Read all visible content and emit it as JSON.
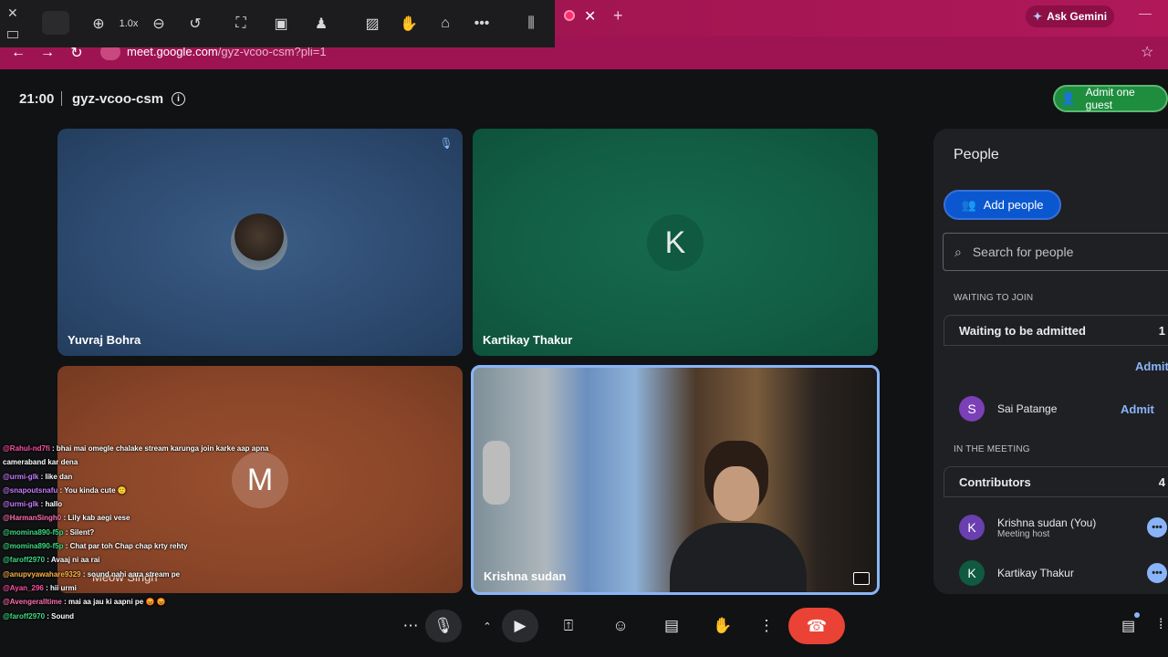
{
  "browser": {
    "url_host": "meet.google.com",
    "url_path": "/gyz-vcoo-csm?pli=1",
    "ask_gemini": "Ask Gemini",
    "tab_new": "+"
  },
  "screen_toolbar": {
    "speed": "1.0x"
  },
  "meeting": {
    "time": "21:00",
    "code": "gyz-vcoo-csm",
    "admit_one_guest": "Admit one guest"
  },
  "tiles": [
    {
      "name": "Yuvraj Bohra",
      "muted": true
    },
    {
      "name": "Kartikay Thakur",
      "initial": "K"
    },
    {
      "name": "Meow Singh",
      "initial": "M"
    },
    {
      "name": "Krishna sudan"
    }
  ],
  "chat": [
    {
      "user": "@Rahul-nd7fi",
      "color": "#ff4fa3",
      "text": "bhai mai omegle chalake stream karunga join karke aap apna"
    },
    {
      "user": "",
      "color": "#ffffff",
      "text": "cameraband kar dena"
    },
    {
      "user": "@urmi-glk",
      "color": "#c77dff",
      "text": "like dan"
    },
    {
      "user": "@snapoutsnafu",
      "color": "#c77dff",
      "text": "You kinda cute 🙂"
    },
    {
      "user": "@urmi-glk",
      "color": "#c77dff",
      "text": "hallo"
    },
    {
      "user": "@HarmanSingh0",
      "color": "#ff6fb1",
      "text": "Lily kab aegi vese"
    },
    {
      "user": "@momina890-f5p",
      "color": "#3ddc84",
      "text": "Silent?"
    },
    {
      "user": "@momina890-f5p",
      "color": "#3ddc84",
      "text": "Chat par toh Chap chap krty rehty"
    },
    {
      "user": "@faroff2970",
      "color": "#3ddc84",
      "text": "Avaaj ni aa rai"
    },
    {
      "user": "@anupvyawahare9329",
      "color": "#ffb347",
      "text": "sound nahi aara stream pe"
    },
    {
      "user": "@Ayan_296",
      "color": "#ff4fa3",
      "text": "hii urmi"
    },
    {
      "user": "@Avengeralltime",
      "color": "#ff6fb1",
      "text": "mai aa jau ki aapni pe 😡 😡"
    },
    {
      "user": "@faroff2970",
      "color": "#3ddc84",
      "text": "Sound"
    }
  ],
  "people": {
    "title": "People",
    "add_people": "Add people",
    "search_placeholder": "Search for people",
    "waiting_section": "WAITING TO JOIN",
    "waiting_group": "Waiting to be admitted",
    "waiting_count": "1",
    "admit_all": "Admit",
    "waiting": [
      {
        "initial": "S",
        "name": "Sai Patange",
        "action": "Admit",
        "color": "#7b3fb8"
      }
    ],
    "meeting_section": "IN THE MEETING",
    "contributors_label": "Contributors",
    "contributors_count": "4",
    "contributors": [
      {
        "initial": "K",
        "name": "Krishna sudan (You)",
        "sub": "Meeting host",
        "color": "#6a3fb0"
      },
      {
        "initial": "K",
        "name": "Kartikay Thakur",
        "sub": "",
        "color": "#0f5a40"
      }
    ]
  },
  "colors": {
    "hangup": "#ea4335",
    "accent_blue": "#8ab4f8",
    "admit_green": "#1e8e3e"
  }
}
